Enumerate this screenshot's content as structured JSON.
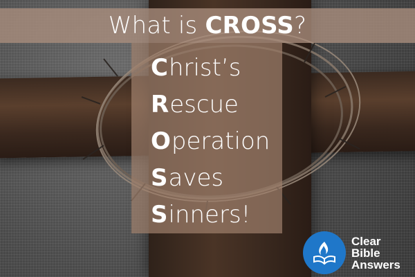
{
  "title": {
    "prefix": "What is ",
    "keyword": "CROSS",
    "suffix": "?"
  },
  "acrostic": [
    {
      "initial": "C",
      "rest": "hrist’s"
    },
    {
      "initial": "R",
      "rest": "escue"
    },
    {
      "initial": "O",
      "rest": "peration"
    },
    {
      "initial": "S",
      "rest": "aves"
    },
    {
      "initial": "S",
      "rest": "inners!"
    }
  ],
  "logo": {
    "line1": "Clear",
    "line2": "Bible",
    "line3": "Answers",
    "icon": "flame-book-icon",
    "circle_color": "#1f77c9"
  },
  "colors": {
    "band": "#aa8e7d",
    "panel": "#a0806c",
    "text": "#ffffff"
  }
}
